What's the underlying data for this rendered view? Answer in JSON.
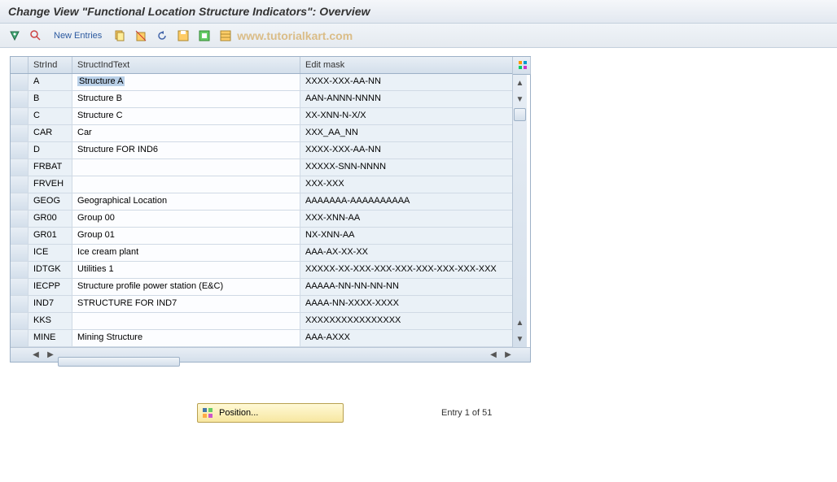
{
  "title": "Change View \"Functional Location Structure Indicators\": Overview",
  "toolbar": {
    "new_entries": "New Entries"
  },
  "watermark": "www.tutorialkart.com",
  "columns": {
    "sel": "",
    "strind": "StrInd",
    "text": "StructIndText",
    "mask": "Edit mask"
  },
  "rows": [
    {
      "strind": "A",
      "text": "Structure A",
      "mask": "XXXX-XXX-AA-NN",
      "highlight": true
    },
    {
      "strind": "B",
      "text": "Structure B",
      "mask": "AAN-ANNN-NNNN"
    },
    {
      "strind": "C",
      "text": "Structure C",
      "mask": "XX-XNN-N-X/X"
    },
    {
      "strind": "CAR",
      "text": "Car",
      "mask": "XXX_AA_NN"
    },
    {
      "strind": "D",
      "text": "Structure FOR IND6",
      "mask": "XXXX-XXX-AA-NN"
    },
    {
      "strind": "FRBAT",
      "text": "",
      "mask": "XXXXX-SNN-NNNN"
    },
    {
      "strind": "FRVEH",
      "text": "",
      "mask": "XXX-XXX"
    },
    {
      "strind": "GEOG",
      "text": "Geographical Location",
      "mask": "AAAAAAA-AAAAAAAAAA"
    },
    {
      "strind": "GR00",
      "text": "Group 00",
      "mask": "XXX-XNN-AA"
    },
    {
      "strind": "GR01",
      "text": "Group 01",
      "mask": "NX-XNN-AA"
    },
    {
      "strind": "ICE",
      "text": "Ice cream plant",
      "mask": "AAA-AX-XX-XX"
    },
    {
      "strind": "IDTGK",
      "text": "Utilities 1",
      "mask": "XXXXX-XX-XXX-XXX-XXX-XXX-XXX-XXX-XXX"
    },
    {
      "strind": "IECPP",
      "text": "Structure profile power station (E&C)",
      "mask": "AAAAA-NN-NN-NN-NN"
    },
    {
      "strind": "IND7",
      "text": "STRUCTURE FOR IND7",
      "mask": "AAAA-NN-XXXX-XXXX"
    },
    {
      "strind": "KKS",
      "text": "",
      "mask": "XXXXXXXXXXXXXXXX"
    },
    {
      "strind": "MINE",
      "text": "Mining Structure",
      "mask": "AAA-AXXX"
    }
  ],
  "footer": {
    "position_label": "Position...",
    "entry_status": "Entry 1 of 51"
  }
}
